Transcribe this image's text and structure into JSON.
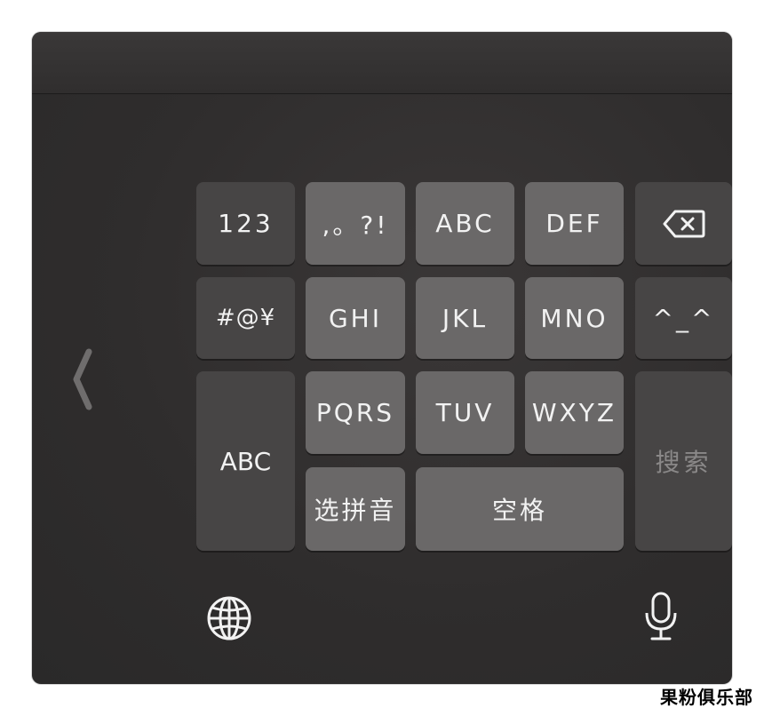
{
  "keyboard": {
    "row1": [
      "123",
      ",。?!",
      "ABC",
      "DEF"
    ],
    "row2": [
      "#@¥",
      "GHI",
      "JKL",
      "MNO",
      "^_^"
    ],
    "row3": [
      "PQRS",
      "TUV",
      "WXYZ"
    ],
    "abc_switch": "ABC",
    "select_pinyin": "选拼音",
    "space": "空格",
    "search": "搜索"
  },
  "icons": {
    "delete": "delete-icon",
    "back": "chevron-left-icon",
    "globe": "globe-icon",
    "mic": "microphone-icon"
  },
  "watermark": "果粉俱乐部"
}
